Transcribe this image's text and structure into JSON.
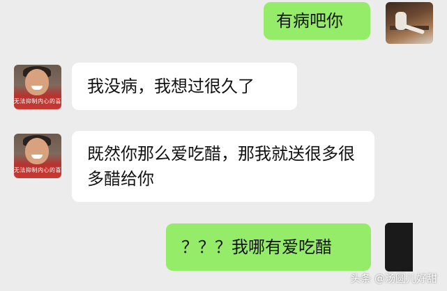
{
  "messages": [
    {
      "side": "out",
      "text": "有病吧你"
    },
    {
      "side": "in",
      "text": "我没病，我想过很久了"
    },
    {
      "side": "in",
      "text": "既然你那么爱吃醋，那我就送很多很多醋给你"
    },
    {
      "side": "out",
      "text": "？？？我哪有爱吃醋"
    }
  ],
  "avatar_caption": "无法抑制内心的喜",
  "watermark": "头条 @汤圆儿好甜",
  "colors": {
    "background": "#ececec",
    "incoming_bubble": "#ffffff",
    "outgoing_bubble": "#95ec69"
  },
  "icons": {
    "contact_avatar": "boy-avatar-icon",
    "self_avatar": "photo-avatar-icon"
  }
}
